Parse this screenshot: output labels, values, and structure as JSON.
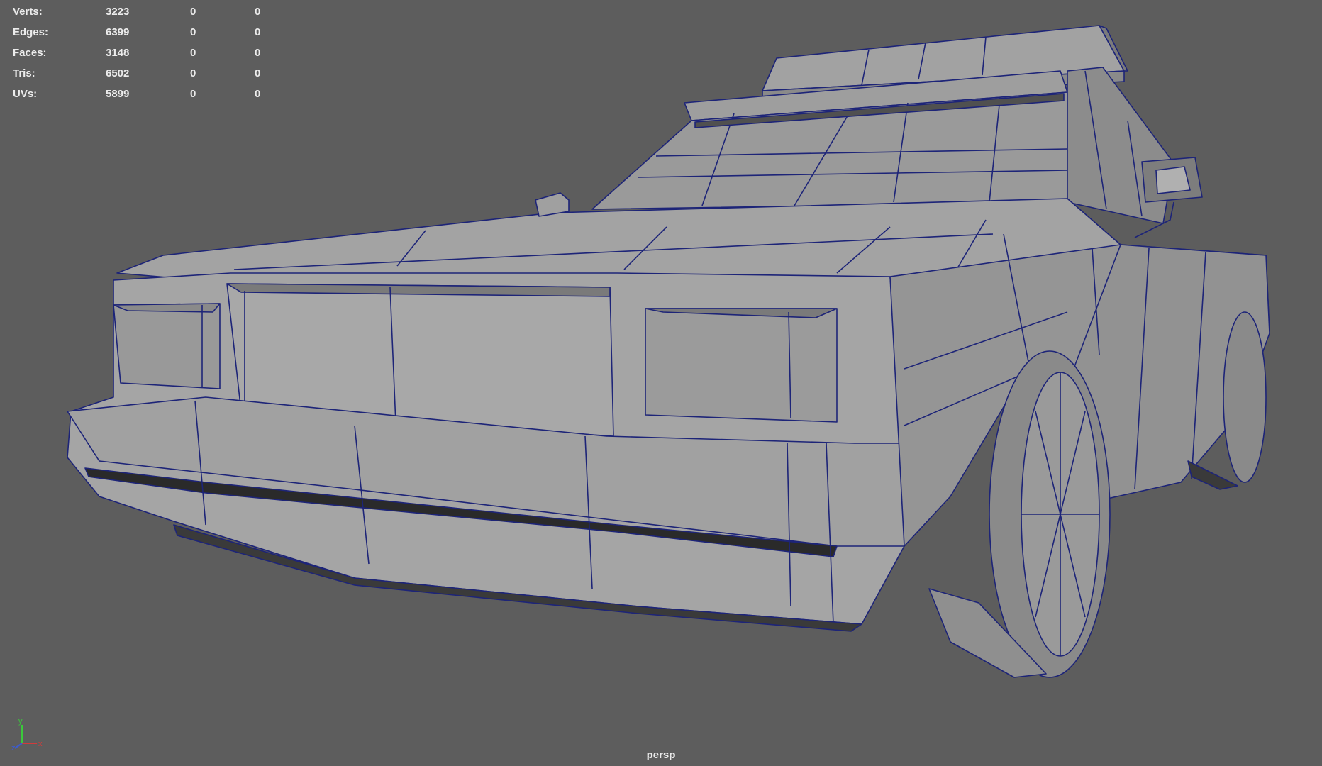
{
  "heads_up_display": {
    "poly_count": [
      {
        "label": "Verts:",
        "values": [
          "3223",
          "0",
          "0"
        ]
      },
      {
        "label": "Edges:",
        "values": [
          "6399",
          "0",
          "0"
        ]
      },
      {
        "label": "Faces:",
        "values": [
          "3148",
          "0",
          "0"
        ]
      },
      {
        "label": "Tris:",
        "values": [
          "6502",
          "0",
          "0"
        ]
      },
      {
        "label": "UVs:",
        "values": [
          "5899",
          "0",
          "0"
        ]
      }
    ]
  },
  "viewport": {
    "camera_name": "persp",
    "background_color": "#5d5d5d",
    "shaded_color": "#9c9c9c",
    "wireframe_color": "#1d2478"
  },
  "axis_gizmo": {
    "x_label": "x",
    "y_label": "y",
    "z_label": "z",
    "x_color": "#d23b3b",
    "y_color": "#3bc83b",
    "z_color": "#3b5bd2"
  }
}
